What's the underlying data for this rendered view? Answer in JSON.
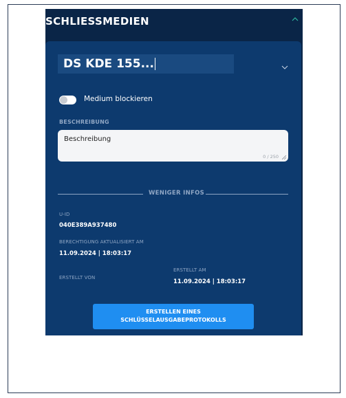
{
  "header": {
    "title": "SCHLIESSMEDIEN"
  },
  "medium": {
    "name": "DS KDE 155..."
  },
  "block_toggle": {
    "label": "Medium blockieren"
  },
  "description": {
    "section_label": "BESCHREIBUNG",
    "placeholder": "Beschreibung",
    "counter": "0 / 250"
  },
  "divider": {
    "label": "WENIGER INFOS"
  },
  "info": {
    "uid_label": "U-ID",
    "uid_value": "040E389A937480",
    "permission_label": "BERECHTIGUNG AKTUALISIERT AM",
    "permission_value": "11.09.2024 | 18:03:17",
    "created_by_label": "ERSTELLT VON",
    "created_at_label": "ERSTELLT AM",
    "created_at_value": "11.09.2024 | 18:03:17"
  },
  "action": {
    "line1": "ERSTELLEN EINES",
    "line2": "SCHLÜSSELAUSGABEPROTOKOLLS"
  },
  "colors": {
    "panel_bg": "#0a2547",
    "card_bg": "#0d3a6e",
    "accent": "#1f8ef1",
    "header_chevron": "#2fb8a0"
  }
}
